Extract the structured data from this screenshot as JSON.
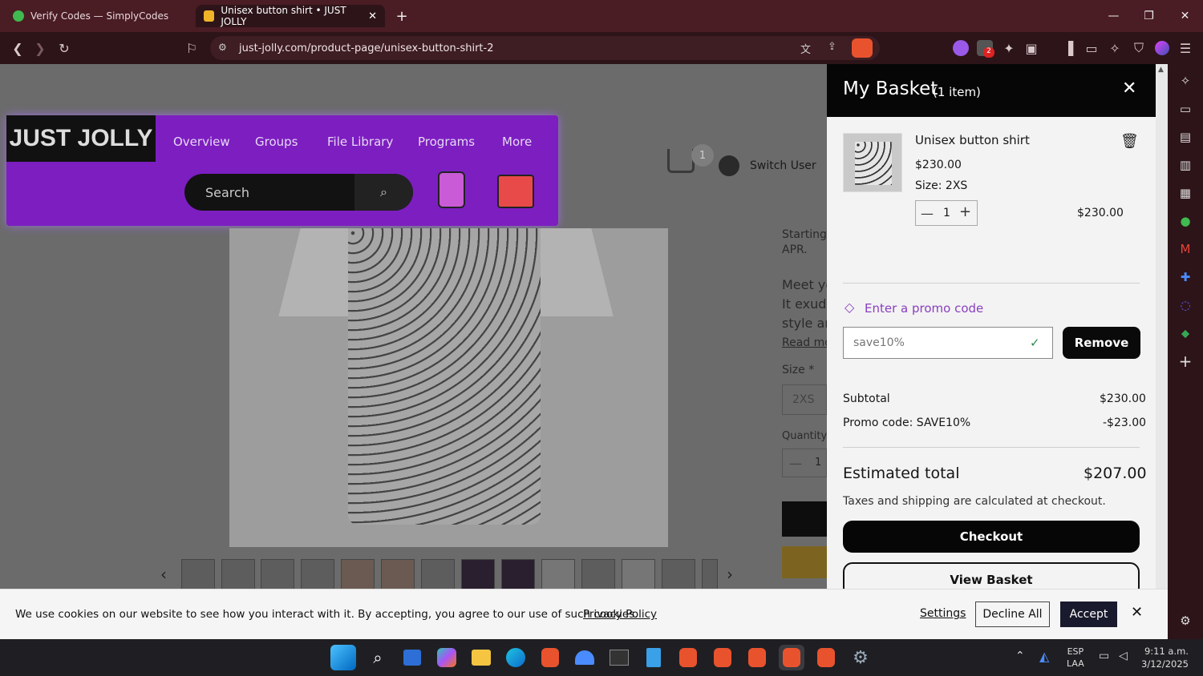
{
  "browser": {
    "tabs": [
      {
        "label": "Verify Codes — SimplyCodes",
        "active": false
      },
      {
        "label": "Unisex button shirt • JUST JOLLY",
        "active": true
      }
    ],
    "url": "just-jolly.com/product-page/unisex-button-shirt-2",
    "extension_badge": "2"
  },
  "site": {
    "logo": "JUST JOLLY",
    "nav": [
      "Overview",
      "Groups",
      "File Library",
      "Programs",
      "More"
    ],
    "search_placeholder": "Search",
    "cart_count": "1",
    "switch_user": "Switch User"
  },
  "product": {
    "starting": "Starting a",
    "apr": "APR.",
    "desc": [
      "Meet yo",
      "It exude",
      "style an"
    ],
    "read_more": "Read mo",
    "size_label": "Size *",
    "size_value": "2XS",
    "quantity_label": "Quantity",
    "quantity_value": "1"
  },
  "basket": {
    "title": "My Basket",
    "count": "(1 item)",
    "item_name": "Unisex button shirt",
    "item_price": "$230.00",
    "item_size": "Size: 2XS",
    "qty": "1",
    "line_total": "$230.00",
    "promo_link": "Enter a promo code",
    "promo_value": "save10%",
    "remove": "Remove",
    "subtotal_label": "Subtotal",
    "subtotal": "$230.00",
    "promo_label": "Promo code: SAVE10%",
    "promo_amount": "-$23.00",
    "est_label": "Estimated total",
    "est_total": "$207.00",
    "taxes_note": "Taxes and shipping are calculated at checkout.",
    "checkout": "Checkout",
    "view_basket": "View Basket"
  },
  "cookie": {
    "text": "We use cookies on our website to see how you interact with it. By accepting, you agree to our use of such cookies.",
    "policy": "Privacy Policy",
    "settings": "Settings",
    "decline": "Decline All",
    "accept": "Accept"
  },
  "taskbar": {
    "lang1": "ESP",
    "lang2": "LAA",
    "time": "9:11 a.m.",
    "date": "3/12/2025"
  }
}
